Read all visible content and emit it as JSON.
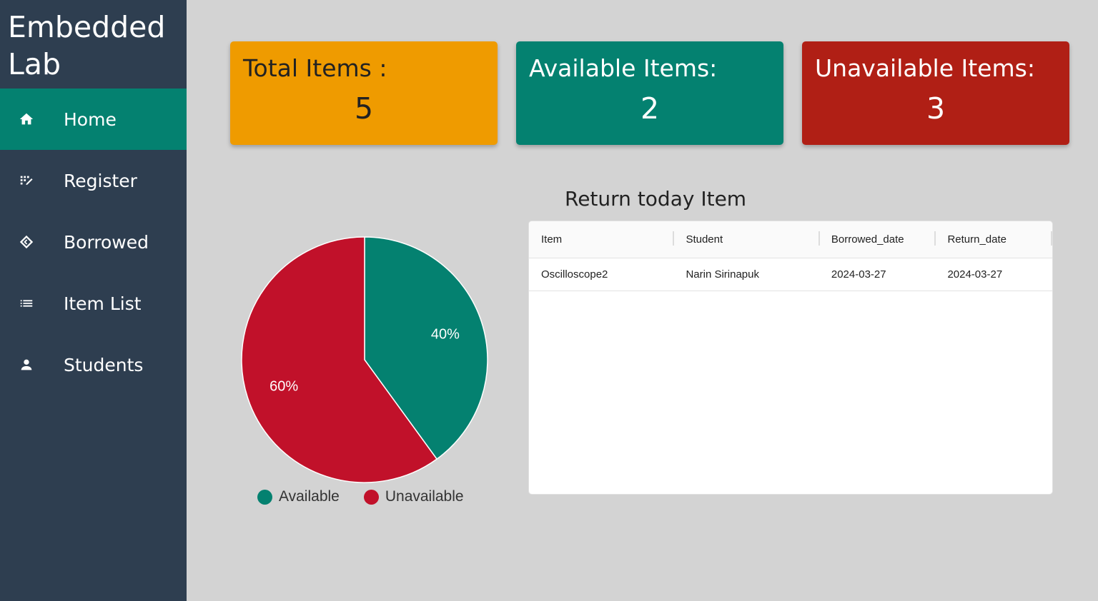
{
  "sidebar": {
    "brand": "Embedded Lab",
    "items": [
      {
        "label": "Home",
        "icon": "home-icon",
        "active": true
      },
      {
        "label": "Register",
        "icon": "register-icon",
        "active": false
      },
      {
        "label": "Borrowed",
        "icon": "borrowed-icon",
        "active": false
      },
      {
        "label": "Item List",
        "icon": "list-icon",
        "active": false
      },
      {
        "label": "Students",
        "icon": "person-icon",
        "active": false
      }
    ]
  },
  "cards": {
    "total": {
      "title": "Total Items :",
      "value": "5",
      "color": "#ef9b00"
    },
    "available": {
      "title": "Available Items:",
      "value": "2",
      "color": "#048170"
    },
    "unavailable": {
      "title": "Unavailable Items:",
      "value": "3",
      "color": "#b01f15"
    }
  },
  "chart_data": {
    "type": "pie",
    "categories": [
      "Available",
      "Unavailable"
    ],
    "values": [
      40,
      60
    ],
    "labels": [
      "40%",
      "60%"
    ],
    "colors": [
      "#048170",
      "#c1112a"
    ],
    "legend": "bottom"
  },
  "return_table": {
    "title": "Return today Item",
    "columns": [
      "Item",
      "Student",
      "Borrowed_date",
      "Return_date"
    ],
    "rows": [
      [
        "Oscilloscope2",
        "Narin Sirinapuk",
        "2024-03-27",
        "2024-03-27"
      ]
    ]
  }
}
